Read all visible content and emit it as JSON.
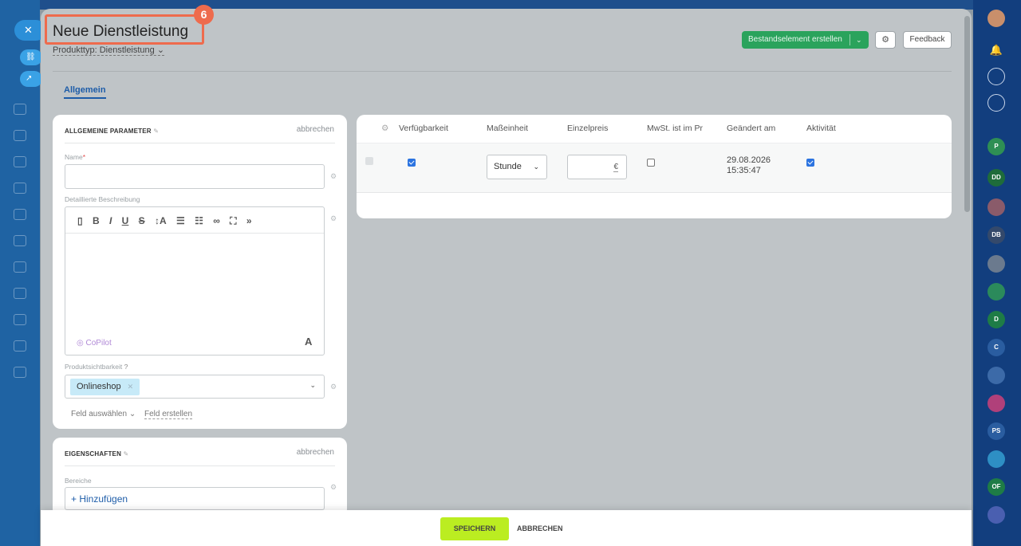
{
  "header": {
    "title": "Neue Dienstleistung",
    "step_badge": "6",
    "product_type": "Produkttyp: Dienstleistung",
    "create_button": "Bestandselement erstellen",
    "feedback_button": "Feedback"
  },
  "tabs": [
    {
      "label": "Allgemein",
      "active": true
    }
  ],
  "general_params": {
    "heading": "ALLGEMEINE PARAMETER",
    "cancel": "abbrechen",
    "name_label": "Name",
    "name_required": "*",
    "name_value": "",
    "description_label": "Detaillierte Beschreibung",
    "copilot_label": "CoPilot",
    "font_label": "A",
    "visibility_label": "Produktsichtbarkeit",
    "visibility_chip": "Onlineshop",
    "select_field": "Feld auswählen",
    "create_field": "Feld erstellen"
  },
  "properties": {
    "heading": "EIGENSCHAFTEN",
    "cancel": "abbrechen",
    "areas_label": "Bereiche",
    "add_button": "+ Hinzufügen"
  },
  "grid": {
    "columns": [
      "Verfügbarkeit",
      "Maßeinheit",
      "Einzelpreis",
      "MwSt. ist im Pr",
      "Geändert am",
      "Aktivität"
    ],
    "row": {
      "available": true,
      "unit": "Stunde",
      "price": "",
      "currency": "€",
      "vat_included": false,
      "changed_date": "29.08.2026",
      "changed_time": "15:35:47",
      "active": true
    }
  },
  "footer": {
    "save": "SPEICHERN",
    "cancel": "ABBRECHEN"
  },
  "right_sidebar": {
    "avatars": [
      "P",
      "DD",
      "DB",
      "D",
      "C",
      "PS",
      "OF"
    ]
  },
  "colors": {
    "accent_blue": "#1d5ca8",
    "green_button": "#2aa35c",
    "save_button": "#bbed21",
    "highlight": "#ee6b4d"
  }
}
